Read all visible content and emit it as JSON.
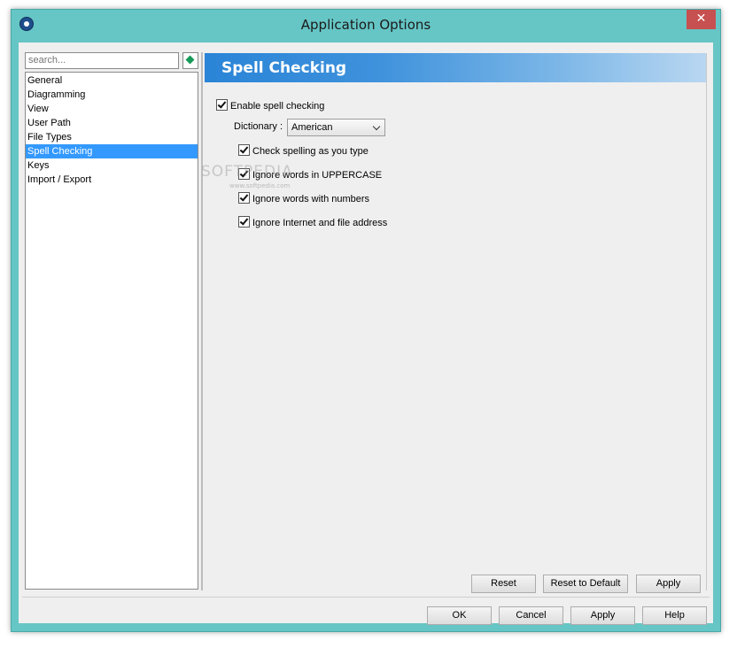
{
  "window": {
    "title": "Application Options"
  },
  "sidebar": {
    "search_placeholder": "search...",
    "items": [
      {
        "label": "General",
        "selected": false
      },
      {
        "label": "Diagramming",
        "selected": false
      },
      {
        "label": "View",
        "selected": false
      },
      {
        "label": "User Path",
        "selected": false
      },
      {
        "label": "File Types",
        "selected": false
      },
      {
        "label": "Spell Checking",
        "selected": true
      },
      {
        "label": "Keys",
        "selected": false
      },
      {
        "label": "Import / Export",
        "selected": false
      }
    ]
  },
  "panel": {
    "title": "Spell Checking",
    "enable": {
      "label": "Enable spell checking",
      "checked": true
    },
    "dictionary": {
      "label": "Dictionary :",
      "value": "American"
    },
    "options": [
      {
        "label": "Check spelling as you type",
        "checked": true
      },
      {
        "label": "Ignore words in UPPERCASE",
        "checked": true
      },
      {
        "label": "Ignore words with numbers",
        "checked": true
      },
      {
        "label": "Ignore Internet and file address",
        "checked": true
      }
    ],
    "buttons": {
      "reset": "Reset",
      "reset_default": "Reset to Default",
      "apply": "Apply"
    }
  },
  "footer": {
    "ok": "OK",
    "cancel": "Cancel",
    "apply": "Apply",
    "help": "Help"
  },
  "watermark": {
    "text": "SOFTPEDIA",
    "sub": "www.softpedia.com"
  },
  "colors": {
    "frame": "#66c5c5",
    "header_start": "#2a84d7",
    "header_end": "#b9d7f1",
    "selection": "#3399ff",
    "close": "#c75050"
  },
  "icons": {
    "app": "app-globe-icon",
    "search": "search-go-icon",
    "close": "close-icon",
    "checkbox": "checkmark-icon",
    "dropdown": "chevron-down-icon"
  }
}
